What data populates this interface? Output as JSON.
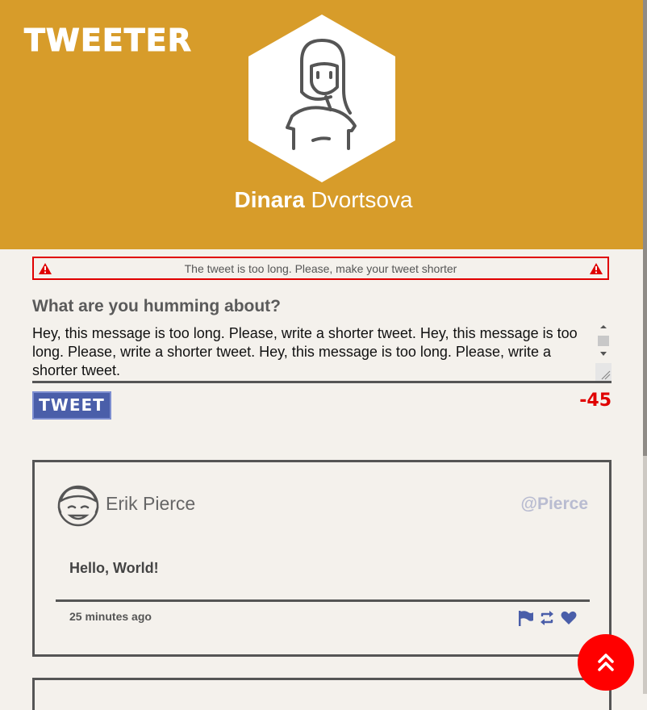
{
  "app": {
    "logo": "TWEETER"
  },
  "profile": {
    "first_name": "Dinara",
    "last_name": "Dvortsova",
    "avatar_icon": "woman-avatar-icon"
  },
  "compose": {
    "error_message": "The tweet is too long. Please, make your tweet shorter",
    "label": "What are you humming about?",
    "text": "Hey, this message is too long. Please, write a shorter tweet. Hey, this message is too long. Please, write a shorter tweet. Hey, this message is too long. Please, write a shorter tweet.",
    "button_label": "TWEET",
    "counter": "-45"
  },
  "tweets": [
    {
      "name": "Erik Pierce",
      "handle": "@Pierce",
      "content": "Hello, World!",
      "time": "25 minutes ago",
      "actions": [
        "flag-icon",
        "retweet-icon",
        "heart-icon"
      ]
    }
  ],
  "colors": {
    "header": "#d79c2a",
    "background": "#f4f1ec",
    "error": "#e00000",
    "button": "#4a5ea9",
    "handle": "#b9bcd1"
  }
}
